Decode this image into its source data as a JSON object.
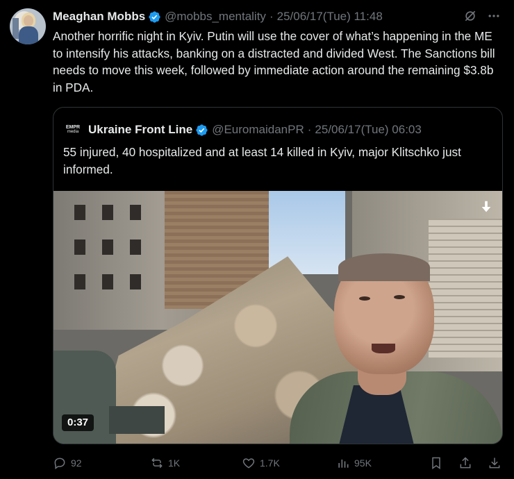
{
  "tweet": {
    "author_name": "Meaghan Mobbs",
    "author_handle": "@mobbs_mentality",
    "separator": "·",
    "timestamp": "25/06/17(Tue) 11:48",
    "text": "Another horrific night in Kyiv. Putin will use the cover of what’s happening in the ME to intensify his attacks, banking on a distracted and divided West. The Sanctions bill needs to move this week, followed by immediate action around the remaining $3.8b in PDA."
  },
  "quoted_tweet": {
    "avatar_line1": "EMPR",
    "avatar_line2": "media",
    "author_name": "Ukraine Front Line",
    "author_handle": "@EuromaidanPR",
    "separator": "·",
    "timestamp": "25/06/17(Tue) 06:03",
    "text": "55 injured, 40 hospitalized and at least 14 killed in Kyiv, major Klitschko just informed.",
    "video_duration": "0:37"
  },
  "actions": {
    "replies": "92",
    "reposts": "1K",
    "likes": "1.7K",
    "views": "95K"
  },
  "colors": {
    "background": "#000000",
    "text_primary": "#e7e9ea",
    "text_secondary": "#71767b",
    "verified_blue": "#1d9bf0",
    "border": "#2f3336"
  }
}
